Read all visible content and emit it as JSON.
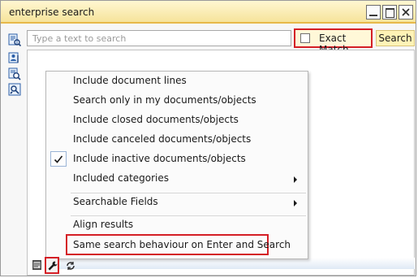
{
  "window": {
    "title": "enterprise search"
  },
  "search": {
    "placeholder": "Type a text to search",
    "value": "",
    "exact_match_label": "Exact Match",
    "exact_match_checked": false,
    "button_label": "Search"
  },
  "sidebar": {
    "icons": [
      "document-search-icon",
      "person-search-icon",
      "object-search-icon",
      "settings-search-icon"
    ]
  },
  "options_menu": {
    "items": [
      {
        "label": "Include document lines",
        "checked": false,
        "submenu": false
      },
      {
        "label": "Search only in my documents/objects",
        "checked": false,
        "submenu": false
      },
      {
        "label": "Include closed documents/objects",
        "checked": false,
        "submenu": false
      },
      {
        "label": "Include canceled documents/objects",
        "checked": false,
        "submenu": false
      },
      {
        "label": "Include inactive documents/objects",
        "checked": true,
        "submenu": false
      },
      {
        "label": "Included categories",
        "checked": false,
        "submenu": true
      },
      {
        "label": "Searchable Fields",
        "checked": false,
        "submenu": true
      },
      {
        "label": "Align results",
        "checked": false,
        "submenu": false
      },
      {
        "label": "Same search behaviour on Enter and Search",
        "checked": false,
        "submenu": false
      }
    ]
  },
  "bottom_toolbar": {
    "icons": [
      "document-icon",
      "wrench-icon",
      "refresh-icon"
    ]
  },
  "colors": {
    "title_bar": "#f6e39b",
    "highlight_border": "#d41f26",
    "search_button": "#fff3b6"
  }
}
